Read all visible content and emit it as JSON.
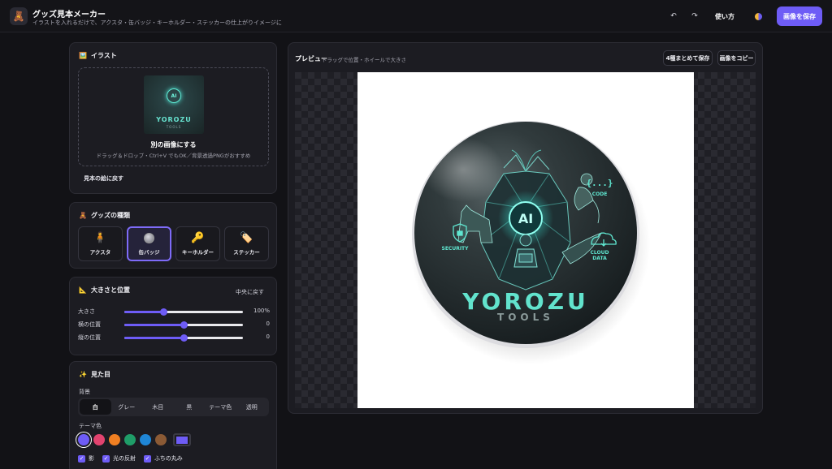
{
  "header": {
    "title": "グッズ見本メーカー",
    "subtitle": "イラストを入れるだけで、アクスタ・缶バッジ・キーホルダー・ステッカーの仕上がりイメージに",
    "undo_icon": "↶",
    "redo_icon": "↷",
    "howto_label": "使い方",
    "save_label": "画像を保存"
  },
  "illust": {
    "title": "イラスト",
    "thumb_badge": "AI",
    "thumb_name": "YOROZU",
    "thumb_sub": "TOOLS",
    "dropzone_title": "別の画像にする",
    "dropzone_hint": "ドラッグ＆ドロップ・Ctrl+V でもOK／背景透過PNGがおすすめ",
    "reset_label": "見本の絵に戻す"
  },
  "goods": {
    "title": "グッズの種類",
    "types": [
      {
        "label": "アクスタ",
        "icon": "🧍"
      },
      {
        "label": "缶バッジ",
        "icon": ""
      },
      {
        "label": "キーホルダー",
        "icon": "🔑"
      },
      {
        "label": "ステッカー",
        "icon": "🏷️"
      }
    ],
    "selected": "缶バッジ"
  },
  "size": {
    "title": "大きさと位置",
    "center_label": "中央に戻す",
    "sliders": [
      {
        "label": "大きさ",
        "value_text": "100%",
        "fraction": 0.33
      },
      {
        "label": "横の位置",
        "value_text": "0",
        "fraction": 0.5
      },
      {
        "label": "縦の位置",
        "value_text": "0",
        "fraction": 0.5
      }
    ]
  },
  "look": {
    "title": "見た目",
    "bg_label": "背景",
    "bg_options": [
      "白",
      "グレー",
      "木目",
      "黒",
      "テーマ色",
      "透明"
    ],
    "bg_selected": "白",
    "theme_label": "テーマ色",
    "theme_colors": [
      "#6e5cf6",
      "#e2436f",
      "#f07f22",
      "#1f9d68",
      "#1f86d6",
      "#8b5a35"
    ],
    "custom_color": "#6e5cf6",
    "checks": [
      {
        "label": "影",
        "checked": true
      },
      {
        "label": "光の反射",
        "checked": true
      },
      {
        "label": "ふちの丸み",
        "checked": true
      }
    ]
  },
  "preview": {
    "title": "プレビュー",
    "hint": "ドラッグで位置・ホイールで大きさ",
    "save4_label": "4種まとめて保存",
    "copy_label": "画像をコピー",
    "badge": {
      "center_label": "AI",
      "name": "YOROZU",
      "sub": "TOOLS",
      "code_symbol": "{...}",
      "code_label": "CODE",
      "security_label": "SECURITY",
      "cloud_label_1": "CLOUD",
      "cloud_label_2": "DATA"
    }
  }
}
